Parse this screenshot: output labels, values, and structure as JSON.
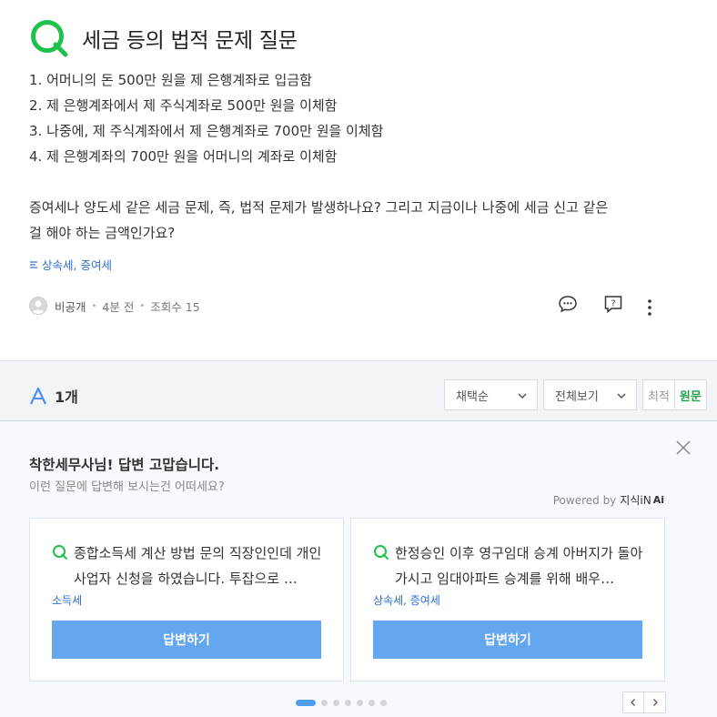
{
  "question": {
    "title": "세금 등의 법적 문제 질문",
    "lines": [
      "1. 어머니의 돈 500만 원을 제 은행계좌로 입금함",
      "2. 제 은행계좌에서 제 주식계좌로 500만 원을 이체함",
      "3. 나중에, 제 주식계좌에서 제 은행계좌로 700만 원을 이체함",
      "4. 제 은행계좌의 700만 원을 어머니의 계좌로 이체함"
    ],
    "paragraph_1": "증여세나 양도세 같은 세금 문제, 즉, 법적 문제가 발생하나요? 그리고 지금이나 나중에 세금 신고 같은",
    "paragraph_2": "걸 해야 하는 금액인가요?",
    "tags": "상속세, 증여세",
    "author": "비공개",
    "time": "4분 전",
    "views": "조회수 15"
  },
  "answers": {
    "count": "1개",
    "sort_label": "채택순",
    "filter_label": "전체보기",
    "toggle_latest": "최적",
    "toggle_original": "원문"
  },
  "recommend": {
    "title": "착한세무사님! 답변 고맙습니다.",
    "subtitle": "이런 질문에 답변해 보시는건 어떠세요?",
    "powered_by": "Powered by",
    "brand": "지식iN",
    "brand_ai": "Ai",
    "cards": [
      {
        "text": "종합소득세 계산 방법 문의 직장인인데 개인사업자 신청을 하였습니다. 투잡으로 …",
        "tag": "소득세",
        "button": "답변하기"
      },
      {
        "text": "한정승인 이후 영구임대 승계 아버지가 돌아가시고 임대아파트 승계를 위해 배우…",
        "tag": "상속세, 증여세",
        "button": "답변하기"
      }
    ]
  }
}
